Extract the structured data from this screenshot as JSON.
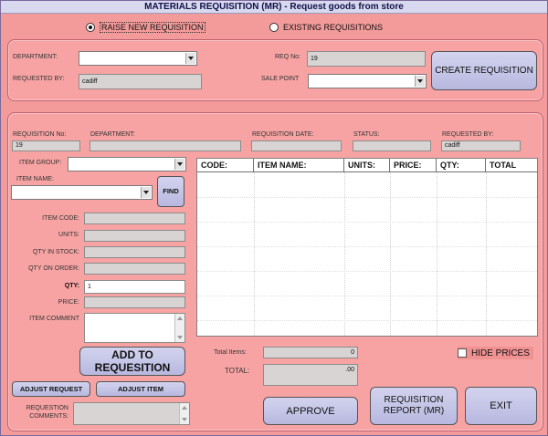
{
  "window": {
    "title": "MATERIALS REQUISITION (MR) - Request goods from store"
  },
  "mode": {
    "raise_label": "RAISE NEW REQUISITION",
    "existing_label": "EXISTING REQUISITIONS",
    "selected": "raise"
  },
  "header_form": {
    "department_label": "DEPARTMENT:",
    "department_value": "",
    "requested_by_label": "REQUESTED BY:",
    "requested_by_value": "cadiff",
    "req_no_label": "REQ No:",
    "req_no_value": "19",
    "sale_point_label": "SALE POINT",
    "sale_point_value": "",
    "create_button": "CREATE REQUISITION"
  },
  "summary": {
    "req_no_label": "REQUISITION No:",
    "req_no_value": "19",
    "department_label": "DEPARTMENT:",
    "department_value": "",
    "date_label": "REQUISITION  DATE:",
    "date_value": "",
    "status_label": "STATUS:",
    "status_value": "",
    "requested_by_label": "REQUESTED BY:",
    "requested_by_value": "cadiff"
  },
  "item_entry": {
    "group_label": "ITEM GROUP:",
    "group_value": "",
    "name_label": "ITEM NAME:",
    "name_value": "",
    "find_button": "FIND",
    "code_label": "ITEM CODE:",
    "code_value": "",
    "units_label": "UNITS:",
    "units_value": "",
    "qty_stock_label": "QTY IN STOCK:",
    "qty_stock_value": "",
    "qty_order_label": "QTY ON ORDER:",
    "qty_order_value": "",
    "qty_label": "QTY:",
    "qty_value": "1",
    "price_label": "PRICE:",
    "price_value": "",
    "comment_label": "ITEM COMMENT",
    "comment_value": "",
    "add_button_line1": "ADD TO",
    "add_button_line2": "REQUESITION",
    "adjust_request_button": "ADJUST REQUEST",
    "adjust_item_button": "ADJUST ITEM",
    "req_comments_label_line1": "REQUESTION",
    "req_comments_label_line2": "COMMENTS:",
    "req_comments_value": ""
  },
  "grid": {
    "columns": [
      "CODE:",
      "ITEM NAME:",
      "UNITS:",
      "PRICE:",
      "QTY:",
      "TOTAL"
    ],
    "rows": []
  },
  "totals": {
    "items_label": "Total Items:",
    "items_value": "0",
    "total_label": "TOTAL:",
    "total_value": ".00",
    "hide_prices_label": "HIDE PRICES",
    "hide_prices_checked": false
  },
  "actions": {
    "approve": "APPROVE",
    "report_line1": "REQUISITION",
    "report_line2": "REPORT (MR)",
    "exit": "EXIT"
  },
  "colors": {
    "background": "#f39a9a",
    "button": "#c6c6e8",
    "title_bar": "#d8d8ee",
    "readonly_field": "#d9d4d4"
  }
}
